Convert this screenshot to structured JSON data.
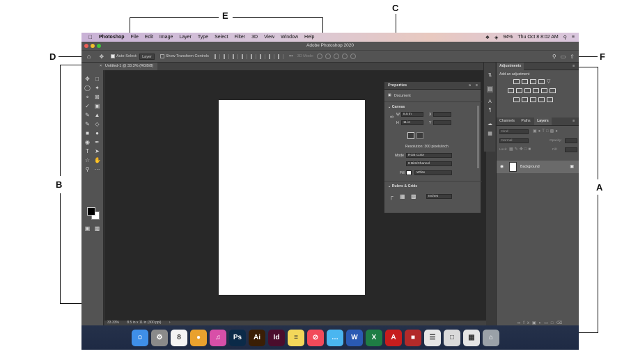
{
  "callouts": {
    "A": "A",
    "B": "B",
    "C": "C",
    "D": "D",
    "E": "E",
    "F": "F"
  },
  "menubar": {
    "apple": "",
    "app": "Photoshop",
    "items": [
      "File",
      "Edit",
      "Image",
      "Layer",
      "Type",
      "Select",
      "Filter",
      "3D",
      "View",
      "Window",
      "Help"
    ],
    "battery": "94%",
    "clock": "Thu Oct 8  8:02 AM"
  },
  "window": {
    "title": "Adobe Photoshop 2020"
  },
  "options_bar": {
    "auto_select": "Auto-Select:",
    "layer_select": "Layer",
    "show_transform": "Show Transform Controls",
    "mode_3d": "3D Mode:"
  },
  "document": {
    "tab_title": "Untitled-1 @ 33.3% (RGB/8)",
    "zoom": "33.33%",
    "doc_size": "8.5 in x 11 in (300 ppi)"
  },
  "properties": {
    "title": "Properties",
    "doc_label": "Document",
    "canvas_section": "Canvas",
    "w_label": "W",
    "w_value": "8.5 in",
    "h_label": "H",
    "h_value": "11 in",
    "x_label": "X",
    "y_label": "Y",
    "resolution": "Resolution: 300 pixels/inch",
    "mode_label": "Mode",
    "mode_value": "RGB Color",
    "bits_value": "8 Bits/Channel",
    "fill_label": "Fill",
    "fill_value": "White",
    "rulers_section": "Rulers & Grids",
    "units_value": "Inches"
  },
  "adjustments": {
    "title": "Adjustments",
    "subtitle": "Add an adjustment"
  },
  "layers": {
    "tabs": [
      "Channels",
      "Paths",
      "Layers"
    ],
    "active_tab": "Layers",
    "kind": "Kind",
    "blend": "Normal",
    "opacity": "Opacity:",
    "lock": "Lock:",
    "fill": "Fill:",
    "layer_name": "Background"
  },
  "dock": {
    "apps": [
      {
        "name": "Finder",
        "label": "☺",
        "color": "#3f8fe8"
      },
      {
        "name": "System Preferences",
        "label": "⚙",
        "color": "#8a8a8a"
      },
      {
        "name": "Calendar",
        "label": "8",
        "color": "#f4f4f4"
      },
      {
        "name": "Chrome",
        "label": "●",
        "color": "#e9a12e"
      },
      {
        "name": "iTunes",
        "label": "♫",
        "color": "#d84fa8"
      },
      {
        "name": "Photoshop",
        "label": "Ps",
        "color": "#0b2a48"
      },
      {
        "name": "Illustrator",
        "label": "Ai",
        "color": "#3a1e05"
      },
      {
        "name": "InDesign",
        "label": "Id",
        "color": "#4a0d2c"
      },
      {
        "name": "Notes",
        "label": "≡",
        "color": "#f3d75a"
      },
      {
        "name": "News",
        "label": "⊘",
        "color": "#f24a5a"
      },
      {
        "name": "Messages",
        "label": "…",
        "color": "#4ab6f0"
      },
      {
        "name": "Word",
        "label": "W",
        "color": "#2a5ab3"
      },
      {
        "name": "Excel",
        "label": "X",
        "color": "#1e7d44"
      },
      {
        "name": "Acrobat",
        "label": "A",
        "color": "#c61d1d"
      },
      {
        "name": "PDF",
        "label": "■",
        "color": "#b22a2a"
      },
      {
        "name": "Document",
        "label": "☰",
        "color": "#e6e6e6"
      },
      {
        "name": "Chrome Window",
        "label": "□",
        "color": "#dadada"
      },
      {
        "name": "Spreadsheet",
        "label": "▦",
        "color": "#e4e4e4"
      },
      {
        "name": "Trash",
        "label": "⌂",
        "color": "#9aa1a8"
      }
    ]
  }
}
